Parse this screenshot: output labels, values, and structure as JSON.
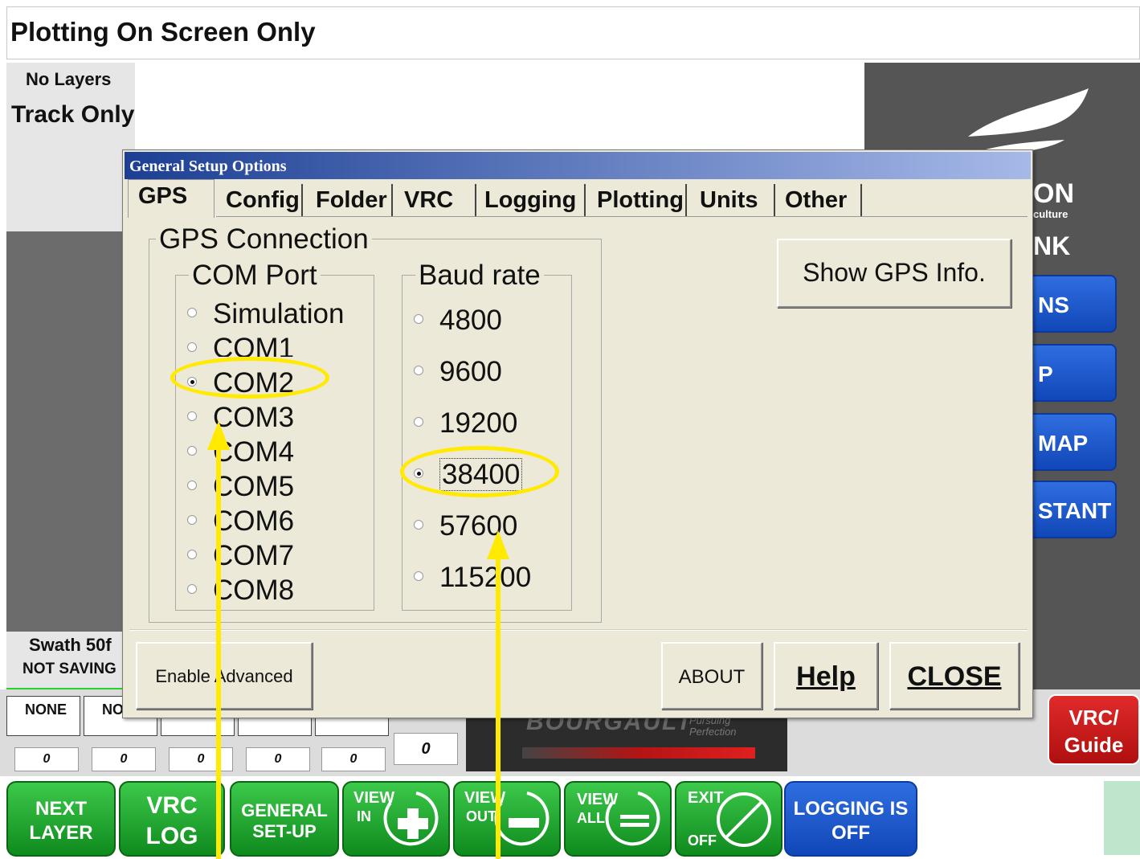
{
  "app": {
    "title": "Plotting On Screen Only",
    "layers_label": "No Layers",
    "track_label": "Track Only",
    "swath_label": "Swath 50f",
    "saving_label": "NOT SAVING"
  },
  "right_panel": {
    "brand_fragment": "ON",
    "brand_sub": "culture",
    "link_fragment": "NK",
    "buttons": [
      "NS",
      "P",
      "MAP",
      "STANT"
    ]
  },
  "status_tiles": {
    "labels": [
      "NONE",
      "NO"
    ],
    "counters": [
      "0",
      "0",
      "0",
      "0",
      "0"
    ],
    "center_counter": "0"
  },
  "brand_strip": {
    "name": "BOURGAULT",
    "tagline_line1": "Pursuing",
    "tagline_line2": "Perfection"
  },
  "vrc_guide": {
    "line1": "VRC/",
    "line2": "Guide"
  },
  "bottom_buttons": {
    "next_layer": [
      "NEXT",
      "LAYER"
    ],
    "vrc_log": [
      "VRC",
      "LOG"
    ],
    "general_setup": [
      "GENERAL",
      "SET-UP"
    ],
    "view_in": [
      "VIEW",
      "IN"
    ],
    "view_out": [
      "VIEW",
      "OUT"
    ],
    "view_all": [
      "VIEW",
      "ALL"
    ],
    "exit": [
      "EXIT",
      "OFF"
    ],
    "logging": [
      "LOGGING",
      "IS OFF"
    ]
  },
  "dialog": {
    "title": "General Setup Options",
    "tabs": [
      "GPS",
      "Config",
      "Folder",
      "VRC",
      "Logging",
      "Plotting",
      "Units",
      "Other"
    ],
    "active_tab": "GPS",
    "gps_connection_caption": "GPS Connection",
    "com_port_caption": "COM Port",
    "com_ports": [
      "Simulation",
      "COM1",
      "COM2",
      "COM3",
      "COM4",
      "COM5",
      "COM6",
      "COM7",
      "COM8"
    ],
    "selected_com_port": "COM2",
    "baud_rate_caption": "Baud rate",
    "baud_rates": [
      "4800",
      "9600",
      "19200",
      "38400",
      "57600",
      "115200"
    ],
    "selected_baud_rate": "38400",
    "show_gps_info_label": "Show GPS Info.",
    "enable_advanced_label": "Enable Advanced",
    "about_label": "ABOUT",
    "help_label": "Help",
    "close_label": "CLOSE"
  },
  "annotation_color": "#ffea00",
  "colors": {
    "green_button": "#1aa22c",
    "blue_button": "#1a55c8",
    "red_button": "#c81a1a",
    "dialog_bg": "#ece9d8",
    "title_bar": "#1c3f94"
  }
}
